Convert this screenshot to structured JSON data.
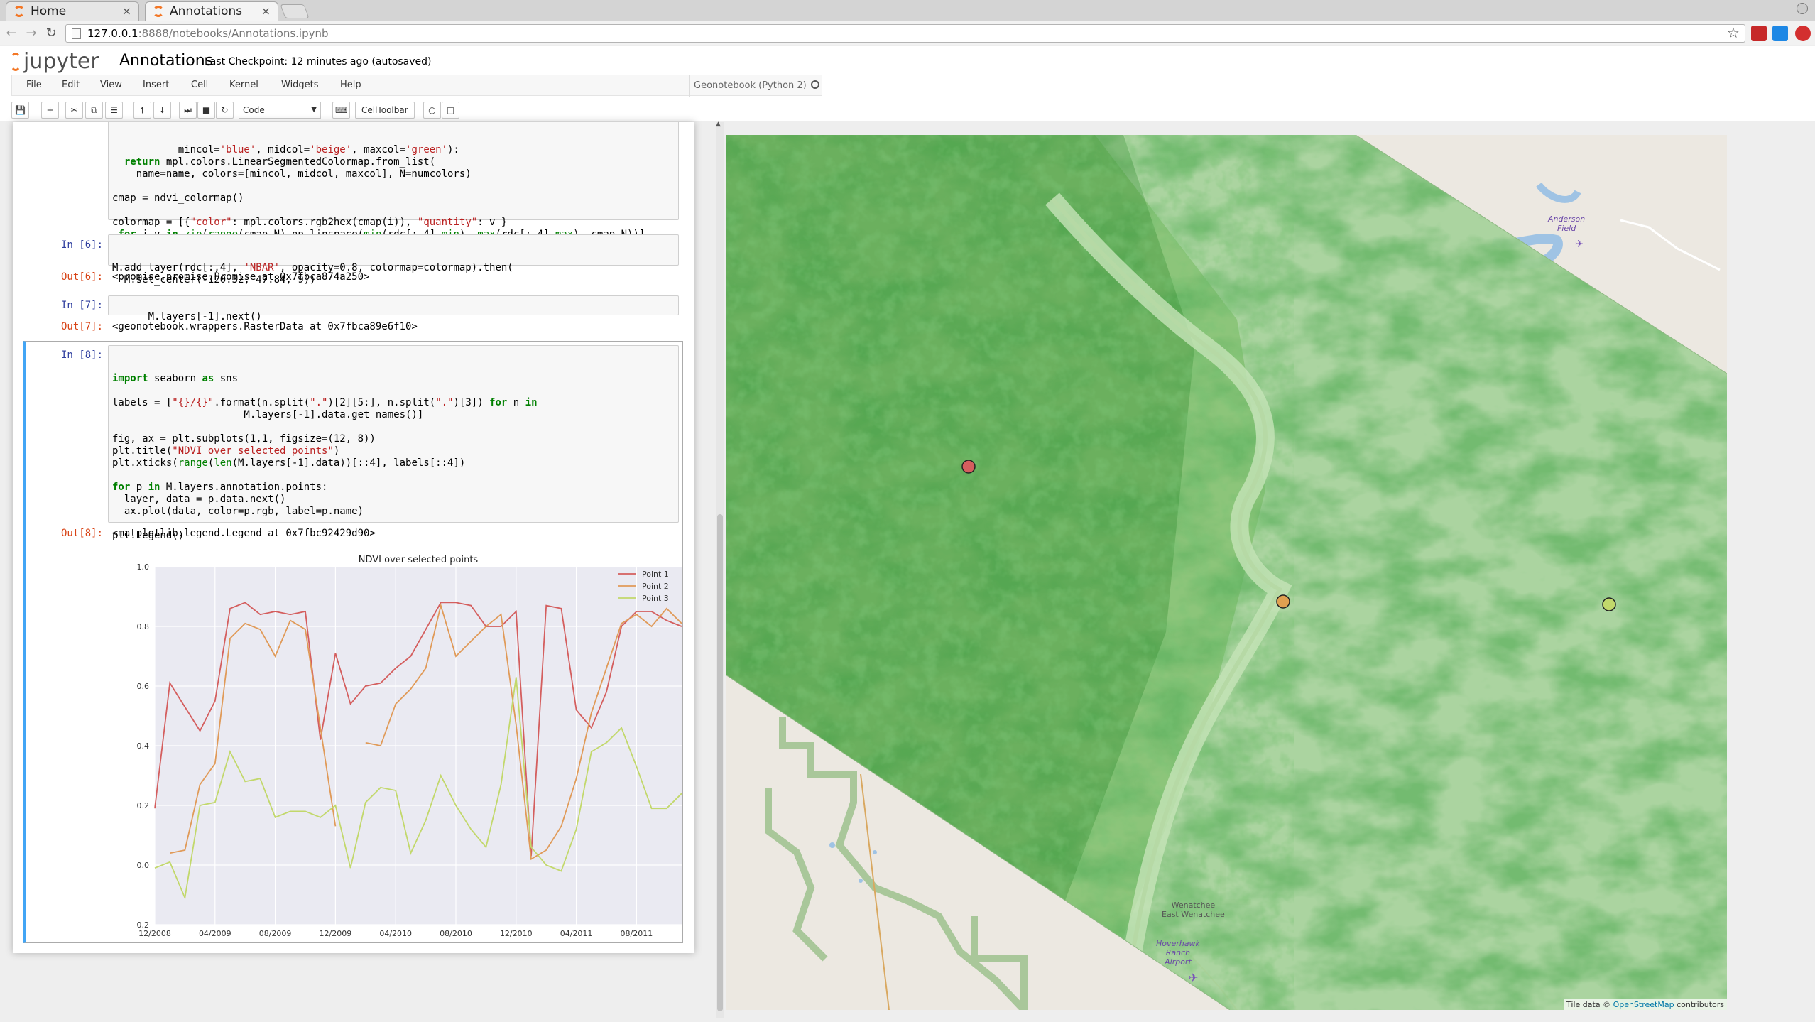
{
  "browser": {
    "tabs": [
      {
        "label": "Home"
      },
      {
        "label": "Annotations"
      }
    ],
    "close_glyph": "×",
    "url_host": "127.0.0.1",
    "url_rest": ":8888/notebooks/Annotations.ipynb"
  },
  "header": {
    "logo_text": "jupyter",
    "notebook_name": "Annotations",
    "checkpoint": "Last Checkpoint: 12 minutes ago (autosaved)"
  },
  "menu": {
    "items": [
      "File",
      "Edit",
      "View",
      "Insert",
      "Cell",
      "Kernel",
      "Widgets",
      "Help"
    ],
    "kernel": "Geonotebook (Python 2)"
  },
  "toolbar": {
    "cell_type": "Code",
    "celltoolbar_label": "CellToolbar",
    "icons": [
      "save-icon",
      "plus-icon",
      "cut-icon",
      "copy-icon",
      "paste-icon",
      "arrow-up-icon",
      "arrow-down-icon",
      "step-forward-icon",
      "stop-icon",
      "refresh-icon"
    ]
  },
  "cells": {
    "c5_code": [
      "           mincol='blue', midcol='beige', maxcol='green'):",
      "  return mpl.colors.LinearSegmentedColormap.from_list(",
      "    name=name, colors=[mincol, midcol, maxcol], N=numcolors)",
      "",
      "cmap = ndvi_colormap()",
      "",
      "colormap = [{\"color\": mpl.colors.rgb2hex(cmap(i)), \"quantity\": v }",
      " for i,v in zip(range(cmap.N),np.linspace(min(rdc[:,4].min), max(rdc[:,4].max), cmap.N))]"
    ],
    "c6_prompt": "In [6]:",
    "c6_code": [
      "M.add_layer(rdc[:,4], 'NBAR', opacity=0.8, colormap=colormap).then(",
      "  M.set_center(-120.32, 47.84, 9))"
    ],
    "c6_out_prompt": "Out[6]:",
    "c6_out": "<promise.promise.Promise at 0x7fbca874a250>",
    "c7_prompt": "In [7]:",
    "c7_code": "M.layers[-1].next()",
    "c7_out_prompt": "Out[7]:",
    "c7_out": "<geonotebook.wrappers.RasterData at 0x7fbca89e6f10>",
    "c8_prompt": "In [8]:",
    "c8_code": [
      "import seaborn as sns",
      "",
      "labels = [\"{}/{}\".format(n.split(\".\")[2][5:], n.split(\".\")[3]) for n in",
      "                      M.layers[-1].data.get_names()]",
      "",
      "fig, ax = plt.subplots(1,1, figsize=(12, 8))",
      "plt.title(\"NDVI over selected points\")",
      "plt.xticks(range(len(M.layers[-1].data))[::4], labels[::4])",
      "",
      "for p in M.layers.annotation.points:",
      "  layer, data = p.data.next()",
      "  ax.plot(data, color=p.rgb, label=p.name)",
      "",
      "plt.legend()"
    ],
    "c8_out_prompt": "Out[8]:",
    "c8_out": "<matplotlib.legend.Legend at 0x7fbc92429d90>"
  },
  "chart_data": {
    "type": "line",
    "title": "NDVI over selected points",
    "xlabel": "",
    "ylabel": "",
    "ylim": [
      -0.2,
      1.0
    ],
    "yticks": [
      "1.0",
      "0.8",
      "0.6",
      "0.4",
      "0.2",
      "0.0",
      "−0.2"
    ],
    "xticks": [
      "12/2008",
      "04/2009",
      "08/2009",
      "12/2009",
      "04/2010",
      "08/2010",
      "12/2010",
      "04/2011",
      "08/2011"
    ],
    "n_points": 36,
    "grid": true,
    "legend": "top-right",
    "series": [
      {
        "name": "Point 1",
        "color": "#d45e5e",
        "values": [
          0.19,
          0.61,
          0.53,
          0.45,
          0.55,
          0.86,
          0.88,
          0.84,
          0.85,
          0.84,
          0.85,
          0.42,
          0.71,
          0.54,
          0.6,
          0.61,
          0.66,
          0.7,
          0.79,
          0.88,
          0.88,
          0.87,
          0.8,
          0.8,
          0.85,
          0.03,
          0.87,
          0.86,
          0.52,
          0.46,
          0.58,
          0.8,
          0.85,
          0.85,
          0.82,
          0.8
        ]
      },
      {
        "name": "Point 2",
        "color": "#e09a58",
        "values": [
          null,
          0.04,
          0.05,
          0.27,
          0.34,
          0.76,
          0.81,
          0.79,
          0.7,
          0.82,
          0.79,
          0.46,
          0.13,
          null,
          0.41,
          0.4,
          0.54,
          0.59,
          0.66,
          0.87,
          0.7,
          0.75,
          0.8,
          0.84,
          0.47,
          0.02,
          0.05,
          0.13,
          0.29,
          0.51,
          0.66,
          0.81,
          0.84,
          0.8,
          0.86,
          0.81
        ]
      },
      {
        "name": "Point 3",
        "color": "#c2d86b",
        "values": [
          -0.01,
          0.01,
          -0.11,
          0.2,
          0.21,
          0.38,
          0.28,
          0.29,
          0.16,
          0.18,
          0.18,
          0.16,
          0.2,
          -0.01,
          0.21,
          0.26,
          0.25,
          0.04,
          0.15,
          0.3,
          0.2,
          0.12,
          0.06,
          0.27,
          0.63,
          0.06,
          0.0,
          -0.02,
          0.12,
          0.38,
          0.41,
          0.46,
          0.33,
          0.19,
          0.19,
          0.24
        ]
      }
    ]
  },
  "map": {
    "labels": [
      {
        "text": "Anderson\nField"
      },
      {
        "text": "Hoverhawk\nRanch\nAirport"
      },
      {
        "text": "Wenatchee\nEast Wenatchee"
      }
    ],
    "attribution_prefix": "Tile data ©",
    "attribution_link": "OpenStreetMap",
    "attribution_suffix": "contributors",
    "points": [
      {
        "name": "Point 1",
        "color": "#d45e5e"
      },
      {
        "name": "Point 2",
        "color": "#e0a050"
      },
      {
        "name": "Point 3",
        "color": "#c2d86b"
      }
    ]
  }
}
